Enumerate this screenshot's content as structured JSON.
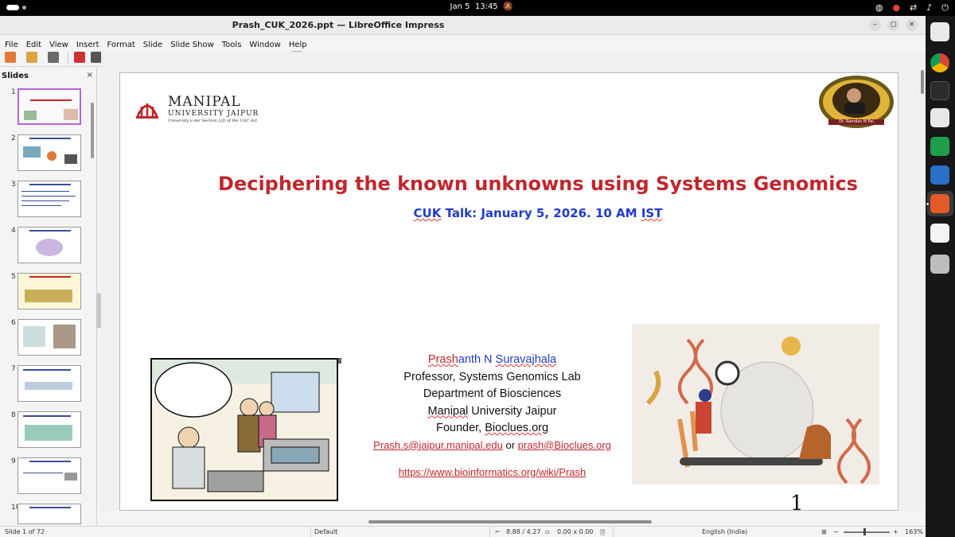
{
  "system_bar": {
    "date": "Jan 5",
    "time": "13:45"
  },
  "window": {
    "title": "Prash_CUK_2026.ppt — LibreOffice Impress"
  },
  "menu": [
    "File",
    "Edit",
    "View",
    "Insert",
    "Format",
    "Slide",
    "Slide Show",
    "Tools",
    "Window",
    "Help"
  ],
  "slides_panel": {
    "title": "Slides",
    "close": "×",
    "numbers": [
      "1",
      "2",
      "3",
      "4",
      "5",
      "6",
      "7",
      "8",
      "9",
      "10"
    ]
  },
  "slide": {
    "logo_name": "MANIPAL",
    "logo_sub": "UNIVERSITY JAIPUR",
    "logo_act": "University u  der Section   2(f) of the UGC Act",
    "badge_text": "Dr. Ramdas M Pai",
    "title": "Deciphering the known unknowns using Systems Genomics",
    "subtitle_pre": "CUK",
    "subtitle_mid": " Talk: January 5, 2026. 10 AM ",
    "subtitle_post": "IST",
    "author_first_a": "Prash",
    "author_first_b": "anth N ",
    "author_last": "Suravajhala",
    "role": "Professor, Systems Genomics Lab",
    "department": "Department of Biosciences",
    "university_a": "Manipal",
    "university_b": " University Jaipur",
    "founder_a": "Founder, ",
    "founder_b": "Bioclues.org",
    "email1": "Prash.s@jaipur.manipal.edu",
    "or": " or ",
    "email2": "prash@Bioclues.org",
    "url": "https://www.bioinformatics.org/wiki/Prash",
    "page_number": "1"
  },
  "status": {
    "slide_of": "Slide 1 of 72",
    "layout": "Default",
    "position": "8.88 / 4.27",
    "size": "0.00 x 0.00",
    "language": "English (India)",
    "zoom": "163%"
  }
}
